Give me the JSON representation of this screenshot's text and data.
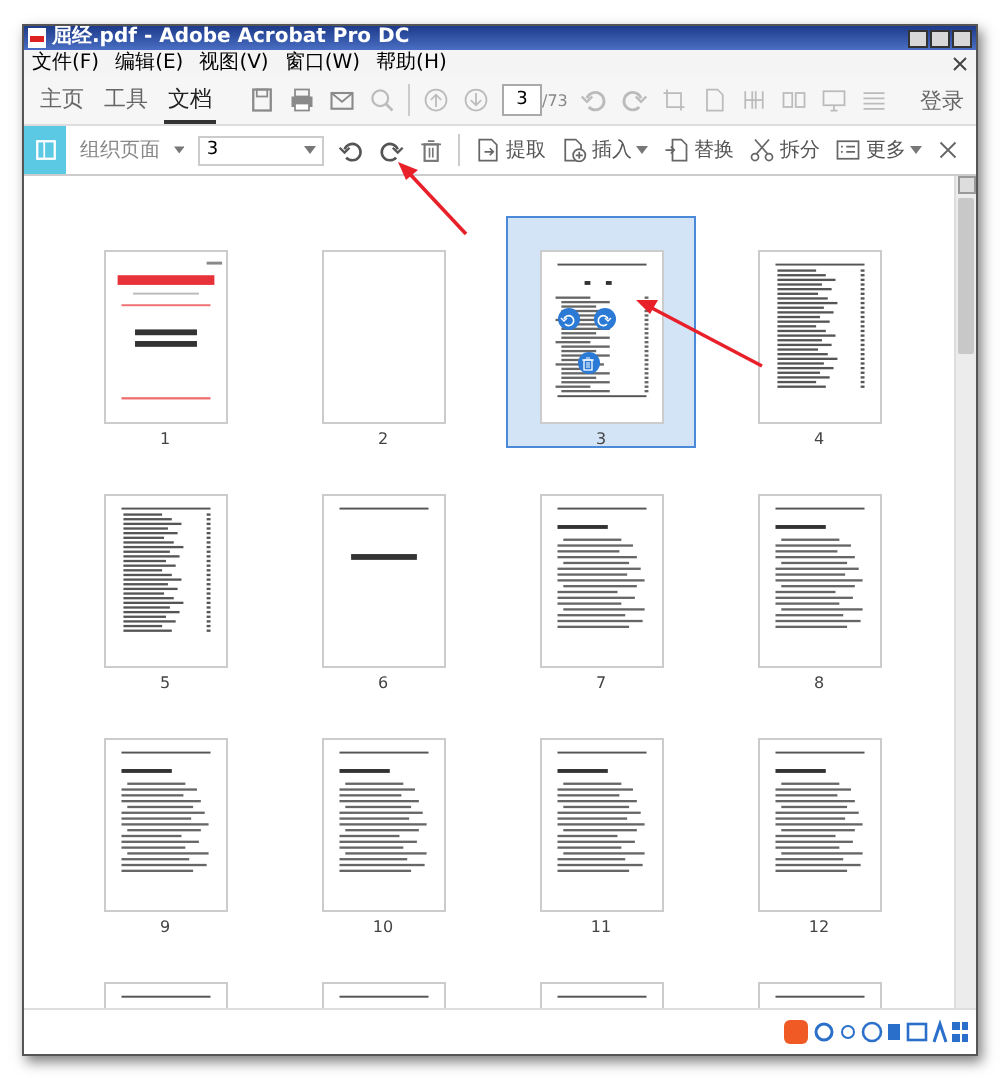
{
  "window": {
    "title": "屈经.pdf - Adobe Acrobat Pro DC"
  },
  "menu": [
    "文件(F)",
    "编辑(E)",
    "视图(V)",
    "窗口(W)",
    "帮助(H)"
  ],
  "tabs": [
    {
      "label": "主页",
      "selected": false
    },
    {
      "label": "工具",
      "selected": false
    },
    {
      "label": "文档",
      "selected": true
    }
  ],
  "page_nav": {
    "page": "3",
    "total": "/73"
  },
  "login": "登录",
  "organize_bar": {
    "title": "组织页面",
    "page_range": "3",
    "actions": [
      {
        "label": "提取",
        "kind": "extract",
        "dropdown": false
      },
      {
        "label": "插入",
        "kind": "insert",
        "dropdown": true
      },
      {
        "label": "替换",
        "kind": "replace",
        "dropdown": false
      },
      {
        "label": "拆分",
        "kind": "split",
        "dropdown": false
      },
      {
        "label": "更多",
        "kind": "more",
        "dropdown": true
      }
    ]
  },
  "pages": [
    {
      "label": "1",
      "kind": "cover",
      "selected": false
    },
    {
      "label": "2",
      "kind": "blank",
      "selected": false
    },
    {
      "label": "3",
      "kind": "toc",
      "selected": true
    },
    {
      "label": "4",
      "kind": "list",
      "selected": false
    },
    {
      "label": "5",
      "kind": "list",
      "selected": false
    },
    {
      "label": "6",
      "kind": "title",
      "selected": false
    },
    {
      "label": "7",
      "kind": "text",
      "selected": false
    },
    {
      "label": "8",
      "kind": "text",
      "selected": false
    },
    {
      "label": "9",
      "kind": "text",
      "selected": false
    },
    {
      "label": "10",
      "kind": "text",
      "selected": false
    },
    {
      "label": "11",
      "kind": "text",
      "selected": false
    },
    {
      "label": "12",
      "kind": "text",
      "selected": false
    },
    {
      "kind": "text",
      "selected": false
    },
    {
      "kind": "text",
      "selected": false
    },
    {
      "kind": "text",
      "selected": false
    },
    {
      "kind": "text",
      "selected": false
    }
  ]
}
